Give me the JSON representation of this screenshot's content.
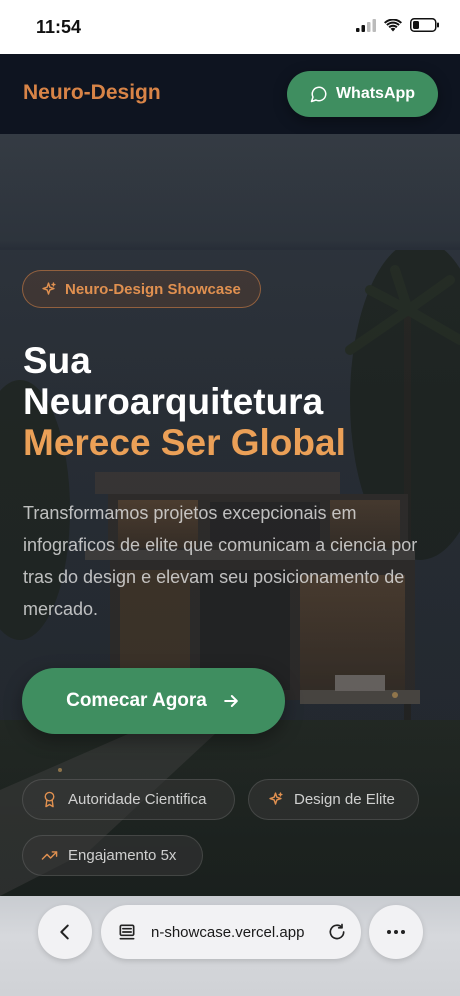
{
  "status": {
    "time": "11:54"
  },
  "header": {
    "brand": "Neuro-Design",
    "whatsapp_label": "WhatsApp"
  },
  "hero": {
    "badge": "Neuro-Design Showcase",
    "headline_line1": "Sua",
    "headline_line2": "Neuroarquitetura",
    "headline_accent": "Merece Ser Global",
    "lead": "Transformamos projetos excepcionais em infograficos de elite que comunicam a ciencia por tras do design e elevam seu posicionamento de mercado.",
    "cta_label": "Comecar Agora",
    "chips": [
      {
        "label": "Autoridade Cientifica",
        "icon": "award-icon"
      },
      {
        "label": "Design de Elite",
        "icon": "sparkles-icon"
      },
      {
        "label": "Engajamento 5x",
        "icon": "trending-up-icon"
      }
    ]
  },
  "browser": {
    "url": "n-showcase.vercel.app"
  },
  "colors": {
    "brand": "#d88447",
    "accent": "#eba057",
    "green": "#3f8e60",
    "header_bg": "#0e1420"
  }
}
